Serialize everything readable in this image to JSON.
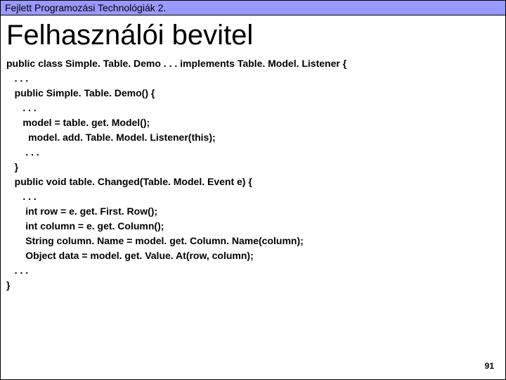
{
  "header": {
    "text": "Fejlett Programozási Technológiák 2."
  },
  "title": "Felhasználói bevitel",
  "code": {
    "l01": "public class Simple. Table. Demo . . . implements Table. Model. Listener {",
    "l02": "   . . .",
    "l03": "   public Simple. Table. Demo() {",
    "l04": "      . . .",
    "l05": "      model = table. get. Model();",
    "l06": "        model. add. Table. Model. Listener(this);",
    "l07": "       . . .",
    "l08": "   }",
    "l09": "   public void table. Changed(Table. Model. Event e) {",
    "l10": "      . . .",
    "l11": "       int row = e. get. First. Row();",
    "l12": "       int column = e. get. Column();",
    "l13": "       String column. Name = model. get. Column. Name(column);",
    "l14": "       Object data = model. get. Value. At(row, column);",
    "l15": "   . . .",
    "l16": "}"
  },
  "page_number": "91"
}
